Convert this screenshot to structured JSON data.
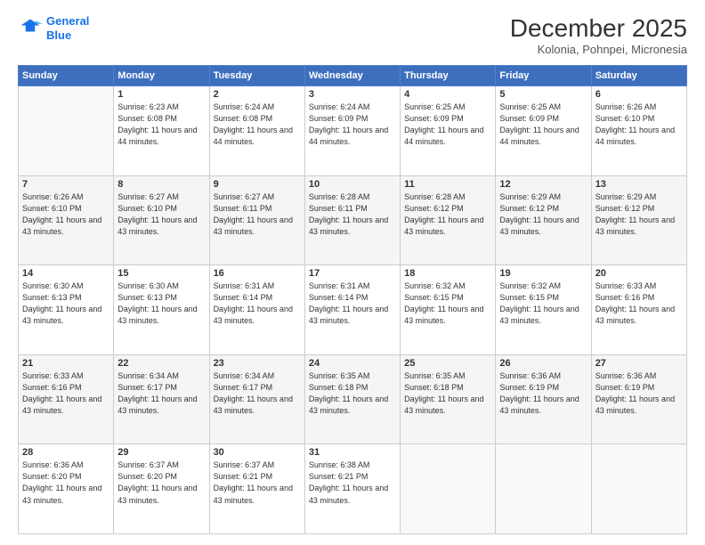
{
  "logo": {
    "line1": "General",
    "line2": "Blue"
  },
  "header": {
    "title": "December 2025",
    "subtitle": "Kolonia, Pohnpei, Micronesia"
  },
  "weekdays": [
    "Sunday",
    "Monday",
    "Tuesday",
    "Wednesday",
    "Thursday",
    "Friday",
    "Saturday"
  ],
  "weeks": [
    [
      {
        "day": "",
        "empty": true
      },
      {
        "day": "1",
        "sunrise": "Sunrise: 6:23 AM",
        "sunset": "Sunset: 6:08 PM",
        "daylight": "Daylight: 11 hours and 44 minutes."
      },
      {
        "day": "2",
        "sunrise": "Sunrise: 6:24 AM",
        "sunset": "Sunset: 6:08 PM",
        "daylight": "Daylight: 11 hours and 44 minutes."
      },
      {
        "day": "3",
        "sunrise": "Sunrise: 6:24 AM",
        "sunset": "Sunset: 6:09 PM",
        "daylight": "Daylight: 11 hours and 44 minutes."
      },
      {
        "day": "4",
        "sunrise": "Sunrise: 6:25 AM",
        "sunset": "Sunset: 6:09 PM",
        "daylight": "Daylight: 11 hours and 44 minutes."
      },
      {
        "day": "5",
        "sunrise": "Sunrise: 6:25 AM",
        "sunset": "Sunset: 6:09 PM",
        "daylight": "Daylight: 11 hours and 44 minutes."
      },
      {
        "day": "6",
        "sunrise": "Sunrise: 6:26 AM",
        "sunset": "Sunset: 6:10 PM",
        "daylight": "Daylight: 11 hours and 44 minutes."
      }
    ],
    [
      {
        "day": "7",
        "sunrise": "Sunrise: 6:26 AM",
        "sunset": "Sunset: 6:10 PM",
        "daylight": "Daylight: 11 hours and 43 minutes."
      },
      {
        "day": "8",
        "sunrise": "Sunrise: 6:27 AM",
        "sunset": "Sunset: 6:10 PM",
        "daylight": "Daylight: 11 hours and 43 minutes."
      },
      {
        "day": "9",
        "sunrise": "Sunrise: 6:27 AM",
        "sunset": "Sunset: 6:11 PM",
        "daylight": "Daylight: 11 hours and 43 minutes."
      },
      {
        "day": "10",
        "sunrise": "Sunrise: 6:28 AM",
        "sunset": "Sunset: 6:11 PM",
        "daylight": "Daylight: 11 hours and 43 minutes."
      },
      {
        "day": "11",
        "sunrise": "Sunrise: 6:28 AM",
        "sunset": "Sunset: 6:12 PM",
        "daylight": "Daylight: 11 hours and 43 minutes."
      },
      {
        "day": "12",
        "sunrise": "Sunrise: 6:29 AM",
        "sunset": "Sunset: 6:12 PM",
        "daylight": "Daylight: 11 hours and 43 minutes."
      },
      {
        "day": "13",
        "sunrise": "Sunrise: 6:29 AM",
        "sunset": "Sunset: 6:12 PM",
        "daylight": "Daylight: 11 hours and 43 minutes."
      }
    ],
    [
      {
        "day": "14",
        "sunrise": "Sunrise: 6:30 AM",
        "sunset": "Sunset: 6:13 PM",
        "daylight": "Daylight: 11 hours and 43 minutes."
      },
      {
        "day": "15",
        "sunrise": "Sunrise: 6:30 AM",
        "sunset": "Sunset: 6:13 PM",
        "daylight": "Daylight: 11 hours and 43 minutes."
      },
      {
        "day": "16",
        "sunrise": "Sunrise: 6:31 AM",
        "sunset": "Sunset: 6:14 PM",
        "daylight": "Daylight: 11 hours and 43 minutes."
      },
      {
        "day": "17",
        "sunrise": "Sunrise: 6:31 AM",
        "sunset": "Sunset: 6:14 PM",
        "daylight": "Daylight: 11 hours and 43 minutes."
      },
      {
        "day": "18",
        "sunrise": "Sunrise: 6:32 AM",
        "sunset": "Sunset: 6:15 PM",
        "daylight": "Daylight: 11 hours and 43 minutes."
      },
      {
        "day": "19",
        "sunrise": "Sunrise: 6:32 AM",
        "sunset": "Sunset: 6:15 PM",
        "daylight": "Daylight: 11 hours and 43 minutes."
      },
      {
        "day": "20",
        "sunrise": "Sunrise: 6:33 AM",
        "sunset": "Sunset: 6:16 PM",
        "daylight": "Daylight: 11 hours and 43 minutes."
      }
    ],
    [
      {
        "day": "21",
        "sunrise": "Sunrise: 6:33 AM",
        "sunset": "Sunset: 6:16 PM",
        "daylight": "Daylight: 11 hours and 43 minutes."
      },
      {
        "day": "22",
        "sunrise": "Sunrise: 6:34 AM",
        "sunset": "Sunset: 6:17 PM",
        "daylight": "Daylight: 11 hours and 43 minutes."
      },
      {
        "day": "23",
        "sunrise": "Sunrise: 6:34 AM",
        "sunset": "Sunset: 6:17 PM",
        "daylight": "Daylight: 11 hours and 43 minutes."
      },
      {
        "day": "24",
        "sunrise": "Sunrise: 6:35 AM",
        "sunset": "Sunset: 6:18 PM",
        "daylight": "Daylight: 11 hours and 43 minutes."
      },
      {
        "day": "25",
        "sunrise": "Sunrise: 6:35 AM",
        "sunset": "Sunset: 6:18 PM",
        "daylight": "Daylight: 11 hours and 43 minutes."
      },
      {
        "day": "26",
        "sunrise": "Sunrise: 6:36 AM",
        "sunset": "Sunset: 6:19 PM",
        "daylight": "Daylight: 11 hours and 43 minutes."
      },
      {
        "day": "27",
        "sunrise": "Sunrise: 6:36 AM",
        "sunset": "Sunset: 6:19 PM",
        "daylight": "Daylight: 11 hours and 43 minutes."
      }
    ],
    [
      {
        "day": "28",
        "sunrise": "Sunrise: 6:36 AM",
        "sunset": "Sunset: 6:20 PM",
        "daylight": "Daylight: 11 hours and 43 minutes."
      },
      {
        "day": "29",
        "sunrise": "Sunrise: 6:37 AM",
        "sunset": "Sunset: 6:20 PM",
        "daylight": "Daylight: 11 hours and 43 minutes."
      },
      {
        "day": "30",
        "sunrise": "Sunrise: 6:37 AM",
        "sunset": "Sunset: 6:21 PM",
        "daylight": "Daylight: 11 hours and 43 minutes."
      },
      {
        "day": "31",
        "sunrise": "Sunrise: 6:38 AM",
        "sunset": "Sunset: 6:21 PM",
        "daylight": "Daylight: 11 hours and 43 minutes."
      },
      {
        "day": "",
        "empty": true
      },
      {
        "day": "",
        "empty": true
      },
      {
        "day": "",
        "empty": true
      }
    ]
  ]
}
